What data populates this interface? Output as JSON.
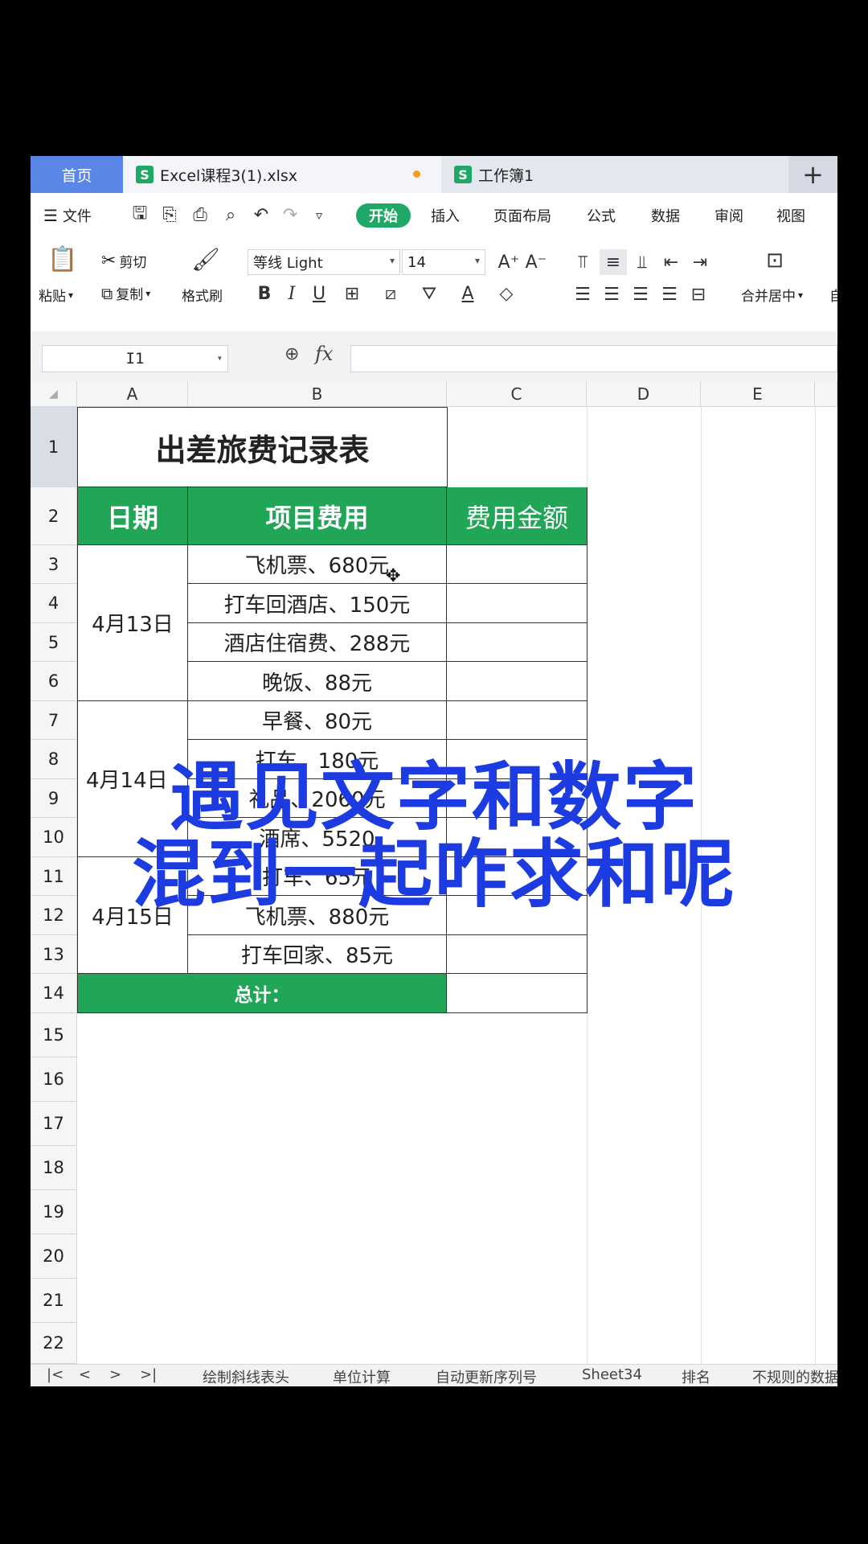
{
  "tabs": {
    "home": "首页",
    "active_file": "Excel课程3(1).xlsx",
    "other_file": "工作簿1",
    "new_tab": "+"
  },
  "menu": {
    "file": "文件",
    "items": [
      "开始",
      "插入",
      "页面布局",
      "公式",
      "数据",
      "审阅",
      "视图"
    ]
  },
  "ribbon": {
    "paste": "粘贴",
    "cut": "剪切",
    "copy": "复制",
    "format_painter": "格式刷",
    "font_name": "等线 Light",
    "font_size": "14",
    "merge_center": "合并居中",
    "auto": "自"
  },
  "formula_bar": {
    "name_box": "I1",
    "fx": "fx",
    "formula": ""
  },
  "columns": [
    "A",
    "B",
    "C",
    "D",
    "E"
  ],
  "rows": [
    "1",
    "2",
    "3",
    "4",
    "5",
    "6",
    "7",
    "8",
    "9",
    "10",
    "11",
    "12",
    "13",
    "14",
    "15",
    "16",
    "17",
    "18",
    "19",
    "20",
    "21",
    "22"
  ],
  "sheet": {
    "title": "出差旅费记录表",
    "headers": [
      "日期",
      "项目费用",
      "费用金额"
    ],
    "dates": [
      "4月13日",
      "4月14日",
      "4月15日"
    ],
    "items": [
      "飞机票、680元",
      "打车回酒店、150元",
      "酒店住宿费、288元",
      "晚饭、88元",
      "早餐、80元",
      "打车、180元",
      "礼品、2060元",
      "酒席、5520",
      "打车、65元",
      "飞机票、880元",
      "打车回家、85元"
    ],
    "total_label": "总计："
  },
  "caption": {
    "line1": "遇见文字和数字",
    "line2": "混到一起咋求和呢"
  },
  "sheet_tabs": [
    "绘制斜线表头",
    "单位计算",
    "自动更新序列号",
    "Sheet34",
    "排名",
    "不规则的数据"
  ],
  "colors": {
    "accent_green": "#21a557",
    "caption_blue": "#1c3be0",
    "home_tab_blue": "#5a86e8"
  }
}
